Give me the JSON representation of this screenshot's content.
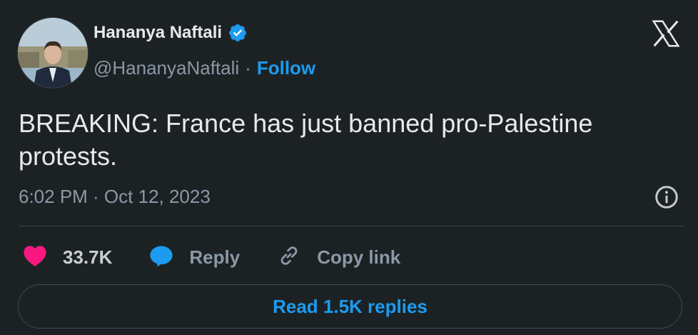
{
  "author": {
    "display_name": "Hananya Naftali",
    "handle": "@HananyaNaftali",
    "separator": "·",
    "follow_label": "Follow",
    "verified": true
  },
  "tweet": {
    "text": "BREAKING: France has just banned pro-Palestine protests.",
    "timestamp": "6:02 PM · Oct 12, 2023"
  },
  "actions": {
    "likes_count": "33.7K",
    "reply_label": "Reply",
    "copy_link_label": "Copy link"
  },
  "footer": {
    "read_replies_label": "Read 1.5K replies"
  },
  "colors": {
    "background": "#1c2224",
    "accent": "#1d9bf0",
    "like": "#f91880",
    "muted_text": "#8b98a5"
  },
  "icons": [
    "verified-badge-icon",
    "x-logo-icon",
    "info-icon",
    "heart-icon",
    "reply-bubble-icon",
    "link-icon"
  ]
}
